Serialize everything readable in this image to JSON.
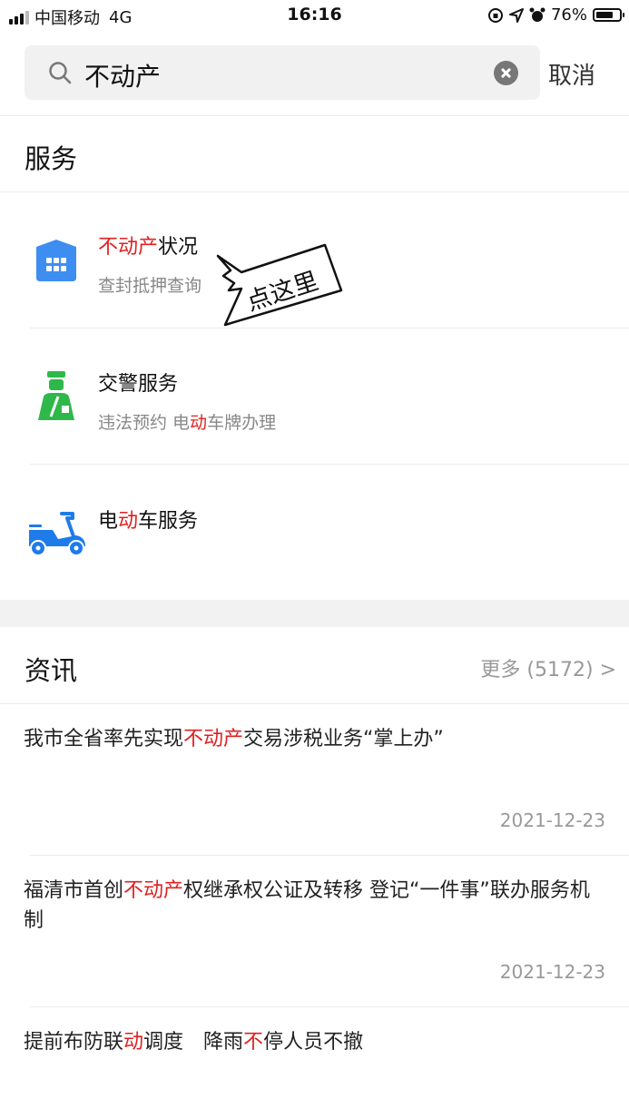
{
  "status_bar": {
    "carrier": "中国移动",
    "network": "4G",
    "time": "16:16",
    "battery_percent": "76%",
    "battery_level": 0.76
  },
  "search": {
    "query": "不动产",
    "cancel_label": "取消"
  },
  "services": {
    "section_title": "服务",
    "items": [
      {
        "title_hl": "不动产",
        "title_rest": "状况",
        "subtitle": "查封抵押查询",
        "icon": "building-icon"
      },
      {
        "title": "交警服务",
        "subtitle_a": "违法预约 电",
        "subtitle_hl": "动",
        "subtitle_b": "车牌办理",
        "icon": "traffic-police-icon"
      },
      {
        "title_a": "电",
        "title_hl": "动",
        "title_b": "车服务",
        "icon": "scooter-icon"
      }
    ],
    "callout_text": "点这里"
  },
  "news": {
    "section_title": "资讯",
    "more_label": "更多 (5172) >",
    "items": [
      {
        "a": "我市全省率先实现",
        "hl": "不动产",
        "b": "交易涉税业务“掌上办”",
        "date": "2021-12-23"
      },
      {
        "a": "福清市首创",
        "hl": "不动产",
        "b": "权继承权公证及转移 登记“一件事”联办服务机制",
        "date": "2021-12-23"
      },
      {
        "a": "提前布防联",
        "hl": "动",
        "b": "调度　降雨",
        "hl2": "不",
        "c": "停人员不撤"
      }
    ]
  },
  "colors": {
    "highlight": "#e02020",
    "icon_blue": "#3d8ef0",
    "icon_green": "#2fb84a"
  }
}
